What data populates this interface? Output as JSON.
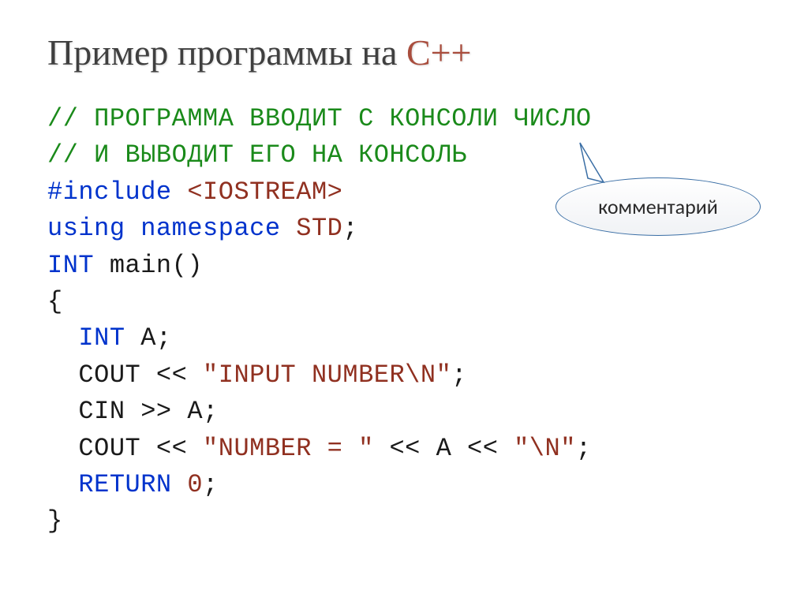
{
  "title_prefix": "Пример программы на ",
  "title_accent": "С++",
  "code": {
    "comment1": "// программа вводит с консоли число",
    "comment2": "// и выводит его на консоль",
    "include_kw": "#include",
    "include_hdr": "<IOSTREAM>",
    "using": "using",
    "namespace": "namespace",
    "std": "STD",
    "semicolon": ";",
    "int": "INT",
    "main": "main",
    "parens": "()",
    "lbrace": "{",
    "a_decl": "A",
    "cout": "COUT",
    "lshift": " << ",
    "str_input": "\"INPUT NUMBER\\N\"",
    "cin": "CIN",
    "rshift": " >> ",
    "a_var": "A",
    "str_number": "\"NUMBER = \"",
    "str_nl": "\"\\N\"",
    "return": "RETURN",
    "zero": "0",
    "rbrace": "}"
  },
  "callout_label": "комментарий"
}
